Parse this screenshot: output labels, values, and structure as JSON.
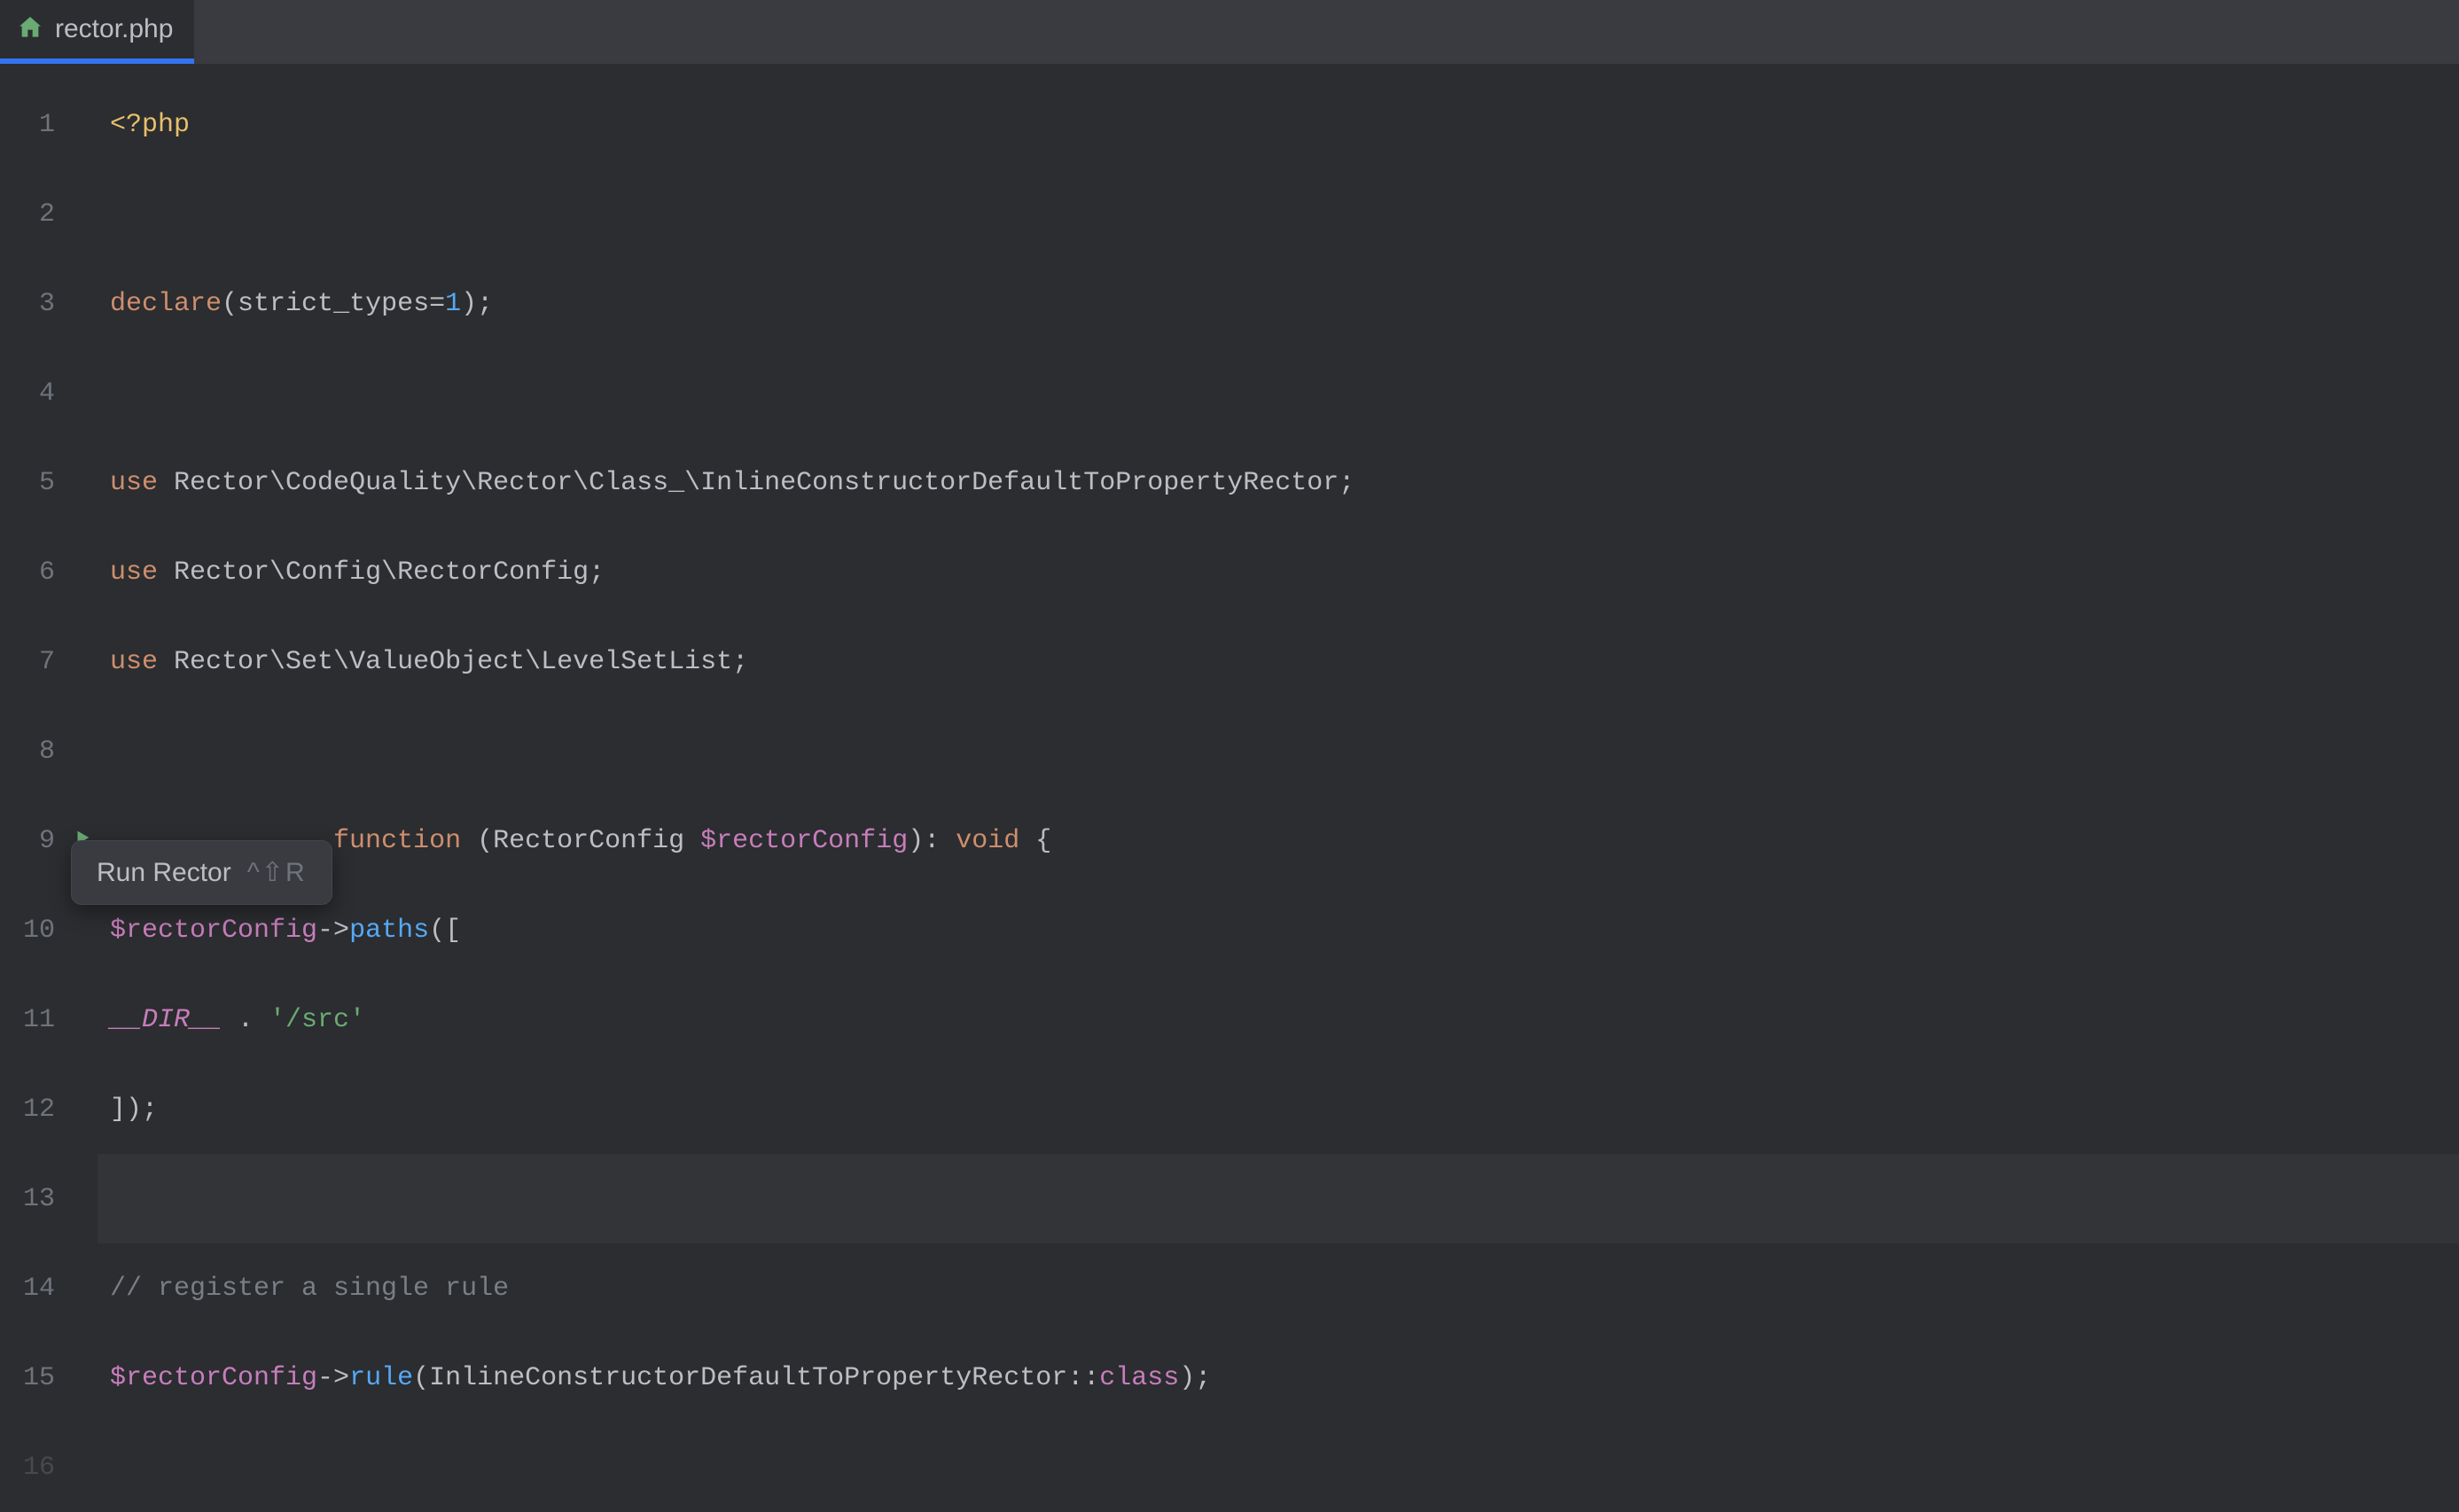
{
  "tab": {
    "icon": "home-icon",
    "filename": "rector.php"
  },
  "tooltip": {
    "label": "Run Rector",
    "shortcut": "^⇧R"
  },
  "gutter": {
    "lines": [
      "1",
      "2",
      "3",
      "4",
      "5",
      "6",
      "7",
      "8",
      "9",
      "10",
      "11",
      "12",
      "13",
      "14",
      "15",
      "16"
    ]
  },
  "code": {
    "l1": {
      "tag_open": "<?php"
    },
    "l3": {
      "kw": "declare",
      "ident": "strict_types",
      "eq": "=",
      "num": "1"
    },
    "l5": {
      "kw": "use",
      "ns": "Rector\\CodeQuality\\Rector\\Class_\\InlineConstructorDefaultToPropertyRector"
    },
    "l6": {
      "kw": "use",
      "ns": "Rector\\Config\\RectorConfig"
    },
    "l7": {
      "kw": "use",
      "ns": "Rector\\Set\\ValueObject\\LevelSetList"
    },
    "l9": {
      "kw": "function",
      "type": "RectorConfig",
      "var": "$rectorConfig",
      "ret": "void"
    },
    "l10": {
      "var": "$rectorConfig",
      "call": "paths"
    },
    "l11": {
      "const": "__DIR__",
      "str": "'/src'"
    },
    "l14": {
      "comment": "// register a single rule"
    },
    "l15": {
      "var": "$rectorConfig",
      "call": "rule",
      "cls": "InlineConstructorDefaultToPropertyRector",
      "class_kw": "class"
    }
  }
}
